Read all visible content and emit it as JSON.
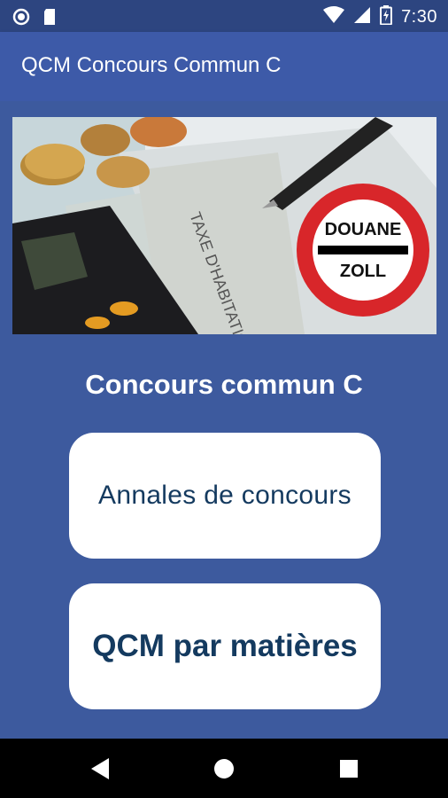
{
  "status_bar": {
    "time": "7:30",
    "left_icons": [
      "circle-icon",
      "sim-card-icon"
    ],
    "right_icons": [
      "wifi-icon",
      "signal-icon",
      "battery-icon"
    ]
  },
  "app_bar": {
    "title": "QCM Concours Commun C"
  },
  "hero": {
    "sign_top": "DOUANE",
    "sign_bottom": "ZOLL",
    "document_text": "TAXE D'HABITATION"
  },
  "main": {
    "heading": "Concours commun C",
    "buttons": [
      {
        "label": "Annales de concours"
      },
      {
        "label": "QCM par matières"
      }
    ]
  },
  "nav_bar": {
    "icons": [
      "back-icon",
      "home-icon",
      "recents-icon"
    ]
  },
  "colors": {
    "status_bar": "#2d4580",
    "app_bar": "#3d5aa8",
    "background": "#3d5a9e",
    "button_text": "#143a5f",
    "sign_red": "#d8262a"
  }
}
